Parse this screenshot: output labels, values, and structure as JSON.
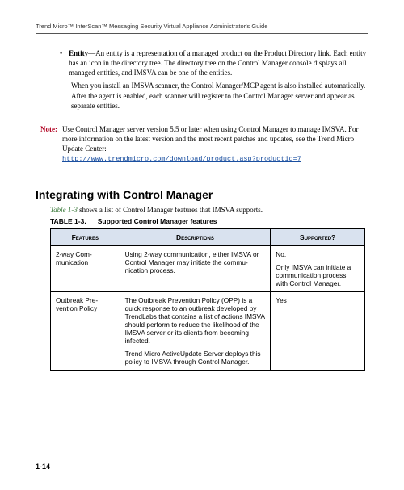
{
  "running_head": "Trend Micro™ InterScan™ Messaging Security Virtual Appliance Administrator's Guide",
  "entity": {
    "bullet_label": "Entity",
    "bullet_text": "—An entity is a representation of a managed product on the Product Directory link. Each entity has an icon in the directory tree. The directory tree on the Control Manager console displays all managed entities, and IMSVA can be one of the entities.",
    "para2": "When you install an IMSVA scanner, the Control Manager/MCP agent is also installed automatically. After the agent is enabled, each scanner will register to the Control Manager server and appear as separate entities."
  },
  "note": {
    "label": "Note:",
    "body": "Use Control Manager server version 5.5 or later when using Control Manager to manage IMSVA. For more information on the latest version and the most recent patches and updates, see the Trend Micro Update Center:",
    "link": "http://www.trendmicro.com/download/product.asp?productid=7"
  },
  "section_heading": "Integrating with Control Manager",
  "lead": {
    "tref": "Table 1-3",
    "rest": " shows a list of Control Manager features that IMSVA supports."
  },
  "table_caption": {
    "num": "TABLE 1-3.",
    "title": "Supported Control Manager features"
  },
  "table": {
    "headers": [
      "Features",
      "Descriptions",
      "Supported?"
    ],
    "rows": [
      {
        "feature": "2-way Com­munication",
        "description": "Using 2-way communication, either IMSVA or Control Man­ager may initiate the commu­nication process.",
        "supported_p1": "No.",
        "supported_p2": "Only IMSVA can initiate a communication process with Control Manager."
      },
      {
        "feature": "Outbreak Pre­vention Policy",
        "description": "The Outbreak Prevention Pol­icy (OPP) is a quick response to an outbreak developed by TrendLabs that contains a list of actions IMSVA should per­form to reduce the likelihood of the IMSVA server or its cli­ents from becoming infected.",
        "description_p2": "Trend Micro ActiveUpdate Server deploys this policy to IMSVA through Control Man­ager.",
        "supported_p1": "Yes",
        "supported_p2": ""
      }
    ]
  },
  "page_number": "1-14"
}
